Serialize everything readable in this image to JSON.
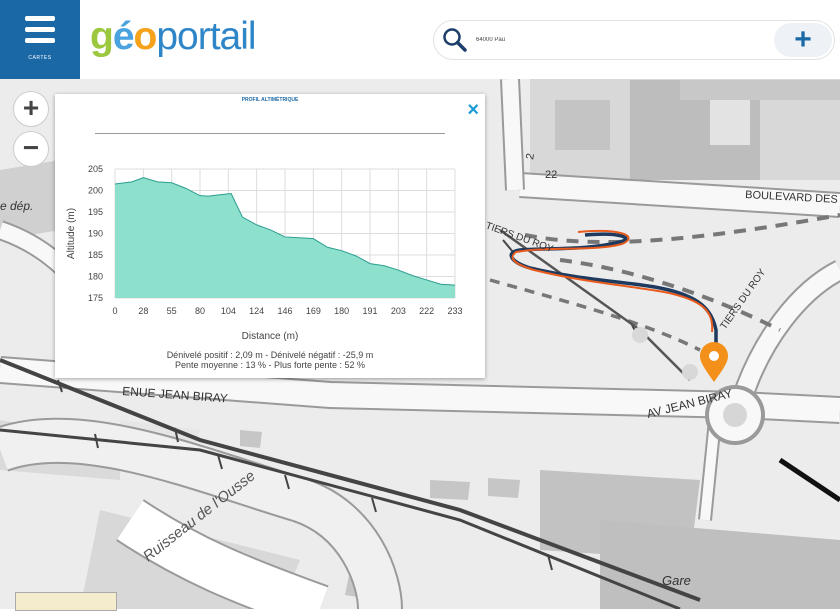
{
  "header": {
    "menu_label": "CARTES",
    "logo": {
      "g": "g",
      "e": "é",
      "o": "o",
      "rest": "portail"
    },
    "search": {
      "value": "64000 Pau",
      "icon": "search-icon"
    },
    "add_label": "+"
  },
  "map": {
    "zoom_in": "+",
    "zoom_out": "−",
    "labels": {
      "boulevard": "BOULEVARD DES P",
      "avenue_left": "ENUE JEAN BIRAY",
      "avenue_right": "AV JEAN BIRAY",
      "sentiers_left": "TIERS DU ROY",
      "sentiers_right": "TIERS DU ROY",
      "ruisseau": "Ruisseau de l'Ousse",
      "gare": "Gare",
      "dep": "e dép.",
      "num_2": "2",
      "num_22": "22"
    }
  },
  "profile": {
    "title": "PROFIL ALTIMÉTRIQUE",
    "close_icon": "×",
    "stats_line1": "Dénivelé positif : 2,09 m - Dénivelé négatif : -25,9 m",
    "stats_line2": "Pente moyenne : 13 % - Plus forte pente : 52 %",
    "fill_color": "#8de0cc",
    "stroke_color": "#2a9d8f"
  },
  "chart_data": {
    "type": "area",
    "title": "",
    "xlabel": "Distance (m)",
    "ylabel": "Altitude (m)",
    "x_ticks": [
      "0",
      "28",
      "55",
      "80",
      "104",
      "124",
      "146",
      "169",
      "180",
      "191",
      "203",
      "222",
      "233"
    ],
    "y_ticks": [
      "175",
      "180",
      "185",
      "190",
      "195",
      "200",
      "205"
    ],
    "ylim": [
      175,
      205
    ],
    "xlim": [
      0,
      12
    ],
    "grid": true,
    "x": [
      0,
      0.6,
      1.0,
      1.5,
      2.0,
      2.5,
      3.0,
      3.3,
      3.7,
      4.1,
      4.5,
      5.0,
      5.5,
      6.0,
      6.5,
      7.0,
      7.5,
      8.0,
      8.5,
      9.0,
      9.5,
      10.0,
      10.5,
      11.0,
      11.5,
      12.0
    ],
    "y": [
      201.5,
      202,
      203,
      202,
      201.8,
      200.5,
      198.8,
      198.7,
      199,
      199.3,
      193.8,
      192,
      190.8,
      189.2,
      189,
      188.8,
      186.8,
      186,
      184.8,
      183,
      182.5,
      181.5,
      180.2,
      179.2,
      178.2,
      178
    ]
  }
}
